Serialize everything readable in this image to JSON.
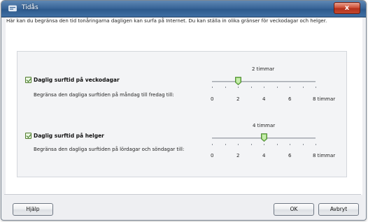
{
  "window": {
    "title": "Tidås",
    "close_symbol": "x"
  },
  "intro_text": "Här kan du begränsa den tid tonåringarna dagligen kan surfa på Internet. Du kan ställa in olika gränser för veckodagar och helger.",
  "sections": [
    {
      "title": "Daglig surftid på veckodagar",
      "checked": true,
      "description": "Begränsa den dagliga surftiden på måndag till fredag till:",
      "value_label": "2 timmar",
      "value": 2,
      "tick_labels": [
        "0",
        "2",
        "4",
        "6",
        "8 timmar"
      ]
    },
    {
      "title": "Daglig surftid på helger",
      "checked": true,
      "description": "Begränsa den dagliga surftiden på lördagar och söndagar till:",
      "value_label": "4 timmar",
      "value": 4,
      "tick_labels": [
        "0",
        "2",
        "4",
        "6",
        "8 timmar"
      ]
    }
  ],
  "slider_range": [
    0,
    8
  ],
  "buttons": {
    "help": "Hjälp",
    "ok": "OK",
    "cancel": "Avbryt"
  },
  "icons": {
    "title": "clock-shield-icon",
    "close": "close-icon",
    "checkbox": "checkmark-icon",
    "slider_thumb": "slider-thumb-icon"
  },
  "colors": {
    "titlebar": "#3a6699",
    "close_button": "#c5482d",
    "checkbox_check": "#2e6d14",
    "slider_thumb": "#5aa83a"
  }
}
